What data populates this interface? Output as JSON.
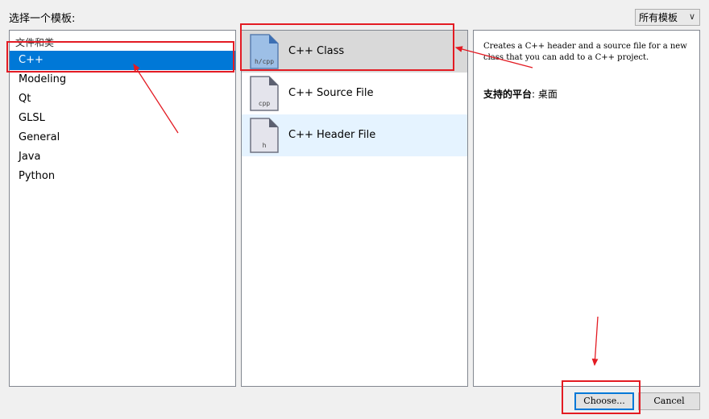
{
  "header": {
    "label": "选择一个模板:"
  },
  "filter": {
    "selected": "所有模板",
    "arrow": "∨"
  },
  "categories": {
    "group_title": "文件和类",
    "items": [
      {
        "label": "C++",
        "selected": true
      },
      {
        "label": "Modeling"
      },
      {
        "label": "Qt"
      },
      {
        "label": "GLSL"
      },
      {
        "label": "General"
      },
      {
        "label": "Java"
      },
      {
        "label": "Python"
      }
    ]
  },
  "templates": {
    "items": [
      {
        "label": "C++ Class",
        "icon_text": "h/cpp",
        "icon": "cpp-class-file-icon",
        "selected": true
      },
      {
        "label": "C++ Source File",
        "icon_text": "cpp",
        "icon": "cpp-source-file-icon"
      },
      {
        "label": "C++ Header File",
        "icon_text": "h",
        "icon": "cpp-header-file-icon",
        "hover": true
      }
    ]
  },
  "description": {
    "text": "Creates a C++ header and a source file for a new class that you can add to a C++ project.",
    "platform_label": "支持的平台",
    "platform_value": ": 桌面"
  },
  "buttons": {
    "choose": "Choose...",
    "cancel": "Cancel"
  },
  "colors": {
    "selection": "#0078d7",
    "annotation": "#e31b23",
    "template_selected": "#d9d9d9",
    "template_hover": "#e5f3ff"
  }
}
